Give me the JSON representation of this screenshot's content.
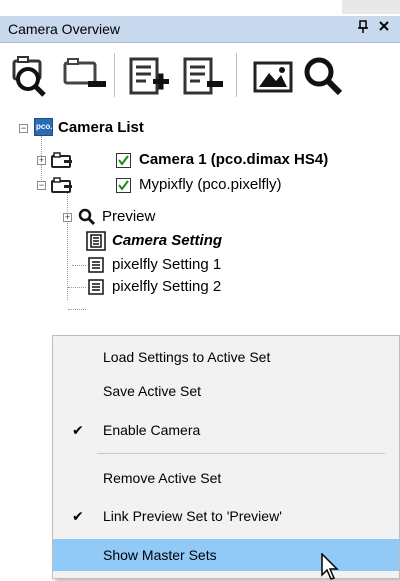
{
  "panel": {
    "title": "Camera Overview",
    "pin_glyph": "ᴩ",
    "close_glyph": "✕"
  },
  "toolbar": {
    "buttons": [
      {
        "icon": "search-camera-icon"
      },
      {
        "icon": "remove-camera-icon"
      },
      {
        "icon": "add-setting-icon"
      },
      {
        "icon": "remove-setting-icon"
      },
      {
        "icon": "image-icon"
      },
      {
        "icon": "magnifier-icon"
      }
    ]
  },
  "tree": {
    "root": {
      "label": "Camera List",
      "logo_text": "pco."
    },
    "camera1": {
      "label": "Camera 1 (pco.dimax HS4)",
      "checked": true
    },
    "camera2": {
      "label": "Mypixfly (pco.pixelfly)",
      "checked": true
    },
    "preview": {
      "label": "Preview"
    },
    "camera_setting": {
      "label": "Camera Setting"
    },
    "setting1": {
      "label": "pixelfly Setting 1"
    },
    "setting2": {
      "label": "pixelfly Setting 2"
    }
  },
  "context_menu": {
    "items": [
      {
        "label": "Load Settings to Active Set",
        "checked": false
      },
      {
        "label": "Save Active Set",
        "checked": false
      },
      {
        "label": "Enable Camera",
        "checked": true
      },
      {
        "label": "Remove Active Set",
        "checked": false
      },
      {
        "label": "Link Preview Set to 'Preview'",
        "checked": true
      },
      {
        "label": "Show Master Sets",
        "checked": false,
        "highlighted": true
      }
    ],
    "check_glyph": "✔",
    "highlight_color": "#91c9f7"
  }
}
